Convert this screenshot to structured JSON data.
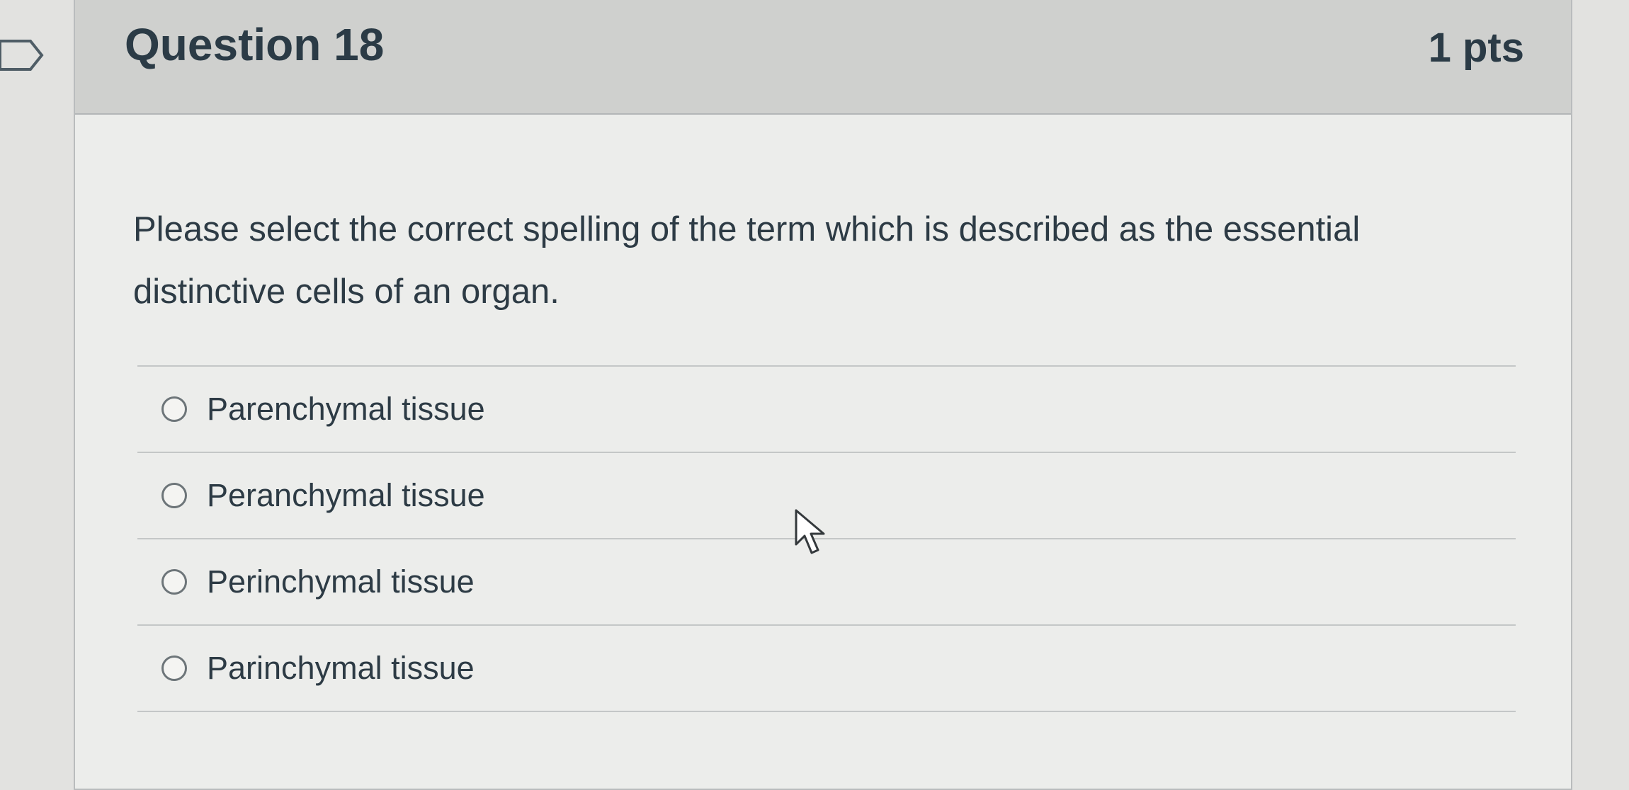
{
  "question": {
    "title": "Question 18",
    "points": "1 pts",
    "prompt": "Please select the correct spelling of the term which is described as the essential distinctive cells of an organ.",
    "answers": [
      {
        "label": "Parenchymal tissue"
      },
      {
        "label": "Peranchymal tissue"
      },
      {
        "label": "Perinchymal tissue"
      },
      {
        "label": "Parinchymal tissue"
      }
    ]
  },
  "icons": {
    "flag": "flag-icon",
    "cursor": "mouse-pointer-icon",
    "radio": "radio-button-icon"
  },
  "colors": {
    "text": "#2d3b45",
    "header": "#cfd0ce",
    "border": "#c4c7c7"
  }
}
